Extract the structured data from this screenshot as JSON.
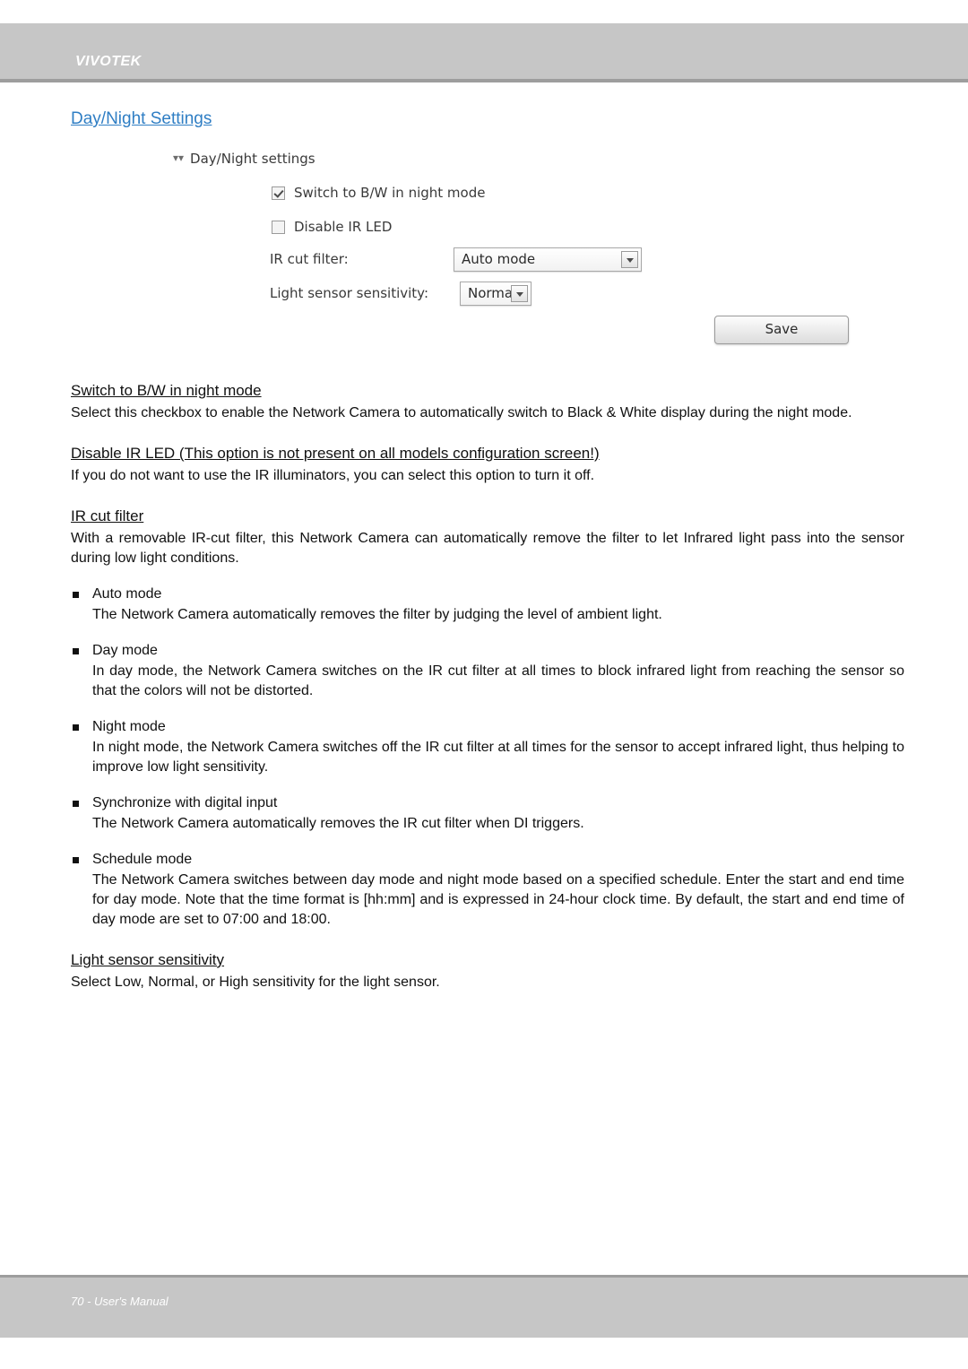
{
  "header": {
    "brand": "VIVOTEK"
  },
  "footer": {
    "text": "70 - User's Manual"
  },
  "page": {
    "section_title": "Day/Night Settings"
  },
  "screenshot": {
    "panel_title": "Day/Night settings",
    "checkbox_bw_label": "Switch to B/W in night mode",
    "checkbox_bw_checked": true,
    "checkbox_ir_label": "Disable IR LED",
    "checkbox_ir_checked": false,
    "ir_cut_filter_label": "IR cut filter:",
    "ir_cut_filter_value": "Auto mode",
    "light_sensor_label": "Light sensor sensitivity:",
    "light_sensor_value": "Normal",
    "save_button": "Save"
  },
  "sections": [
    {
      "heading": "Switch to B/W in night mode",
      "body": "Select this checkbox to enable the Network Camera to automatically switch to Black & White display during the night mode."
    },
    {
      "heading": "Disable IR LED (This option is not present on all models configuration screen!)",
      "body": "If you do not want to use the IR illuminators, you can select this option to turn it off."
    },
    {
      "heading": "IR cut filter",
      "body": "With a removable IR-cut filter, this Network Camera can automatically remove the filter to let Infrared light pass into the sensor during low light conditions."
    }
  ],
  "bullets": [
    {
      "title": "Auto mode",
      "body": "The Network Camera automatically removes the filter by judging the level of ambient light."
    },
    {
      "title": "Day mode",
      "body": "In day mode, the Network Camera switches on the IR cut filter at all times to block infrared light from reaching the sensor so that the colors will not be distorted."
    },
    {
      "title": "Night mode",
      "body": "In night mode, the Network Camera switches off the IR cut filter at all times for the sensor to accept infrared light, thus helping to improve low light sensitivity."
    },
    {
      "title": "Synchronize with digital input",
      "body": "The Network Camera automatically removes the IR cut filter when DI triggers."
    },
    {
      "title": "Schedule mode",
      "body": "The Network Camera switches between day mode and night mode based on a specified schedule. Enter the start and end time for day mode. Note that the time format is [hh:mm] and is expressed in 24-hour clock time. By default, the start and end time of day mode are set to 07:00 and 18:00."
    }
  ],
  "final_section": {
    "heading": "Light sensor sensitivity",
    "body": "Select Low, Normal, or High sensitivity for the light sensor."
  }
}
